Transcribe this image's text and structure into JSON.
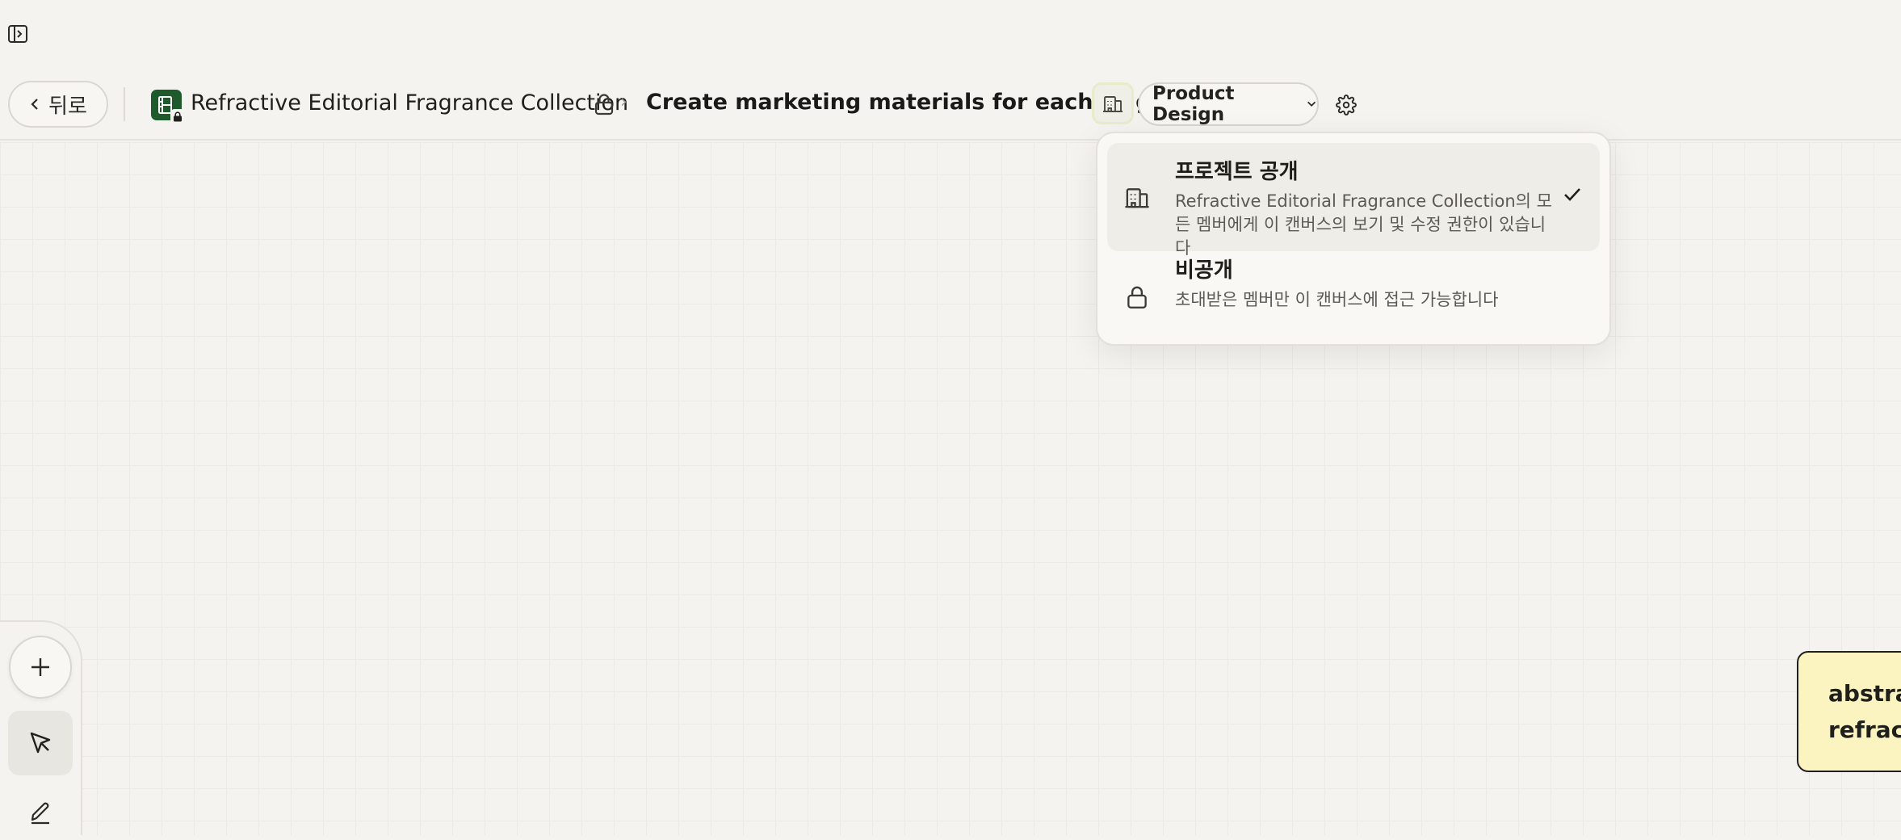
{
  "header": {
    "back_label": "뒤로",
    "project_name": "Refractive Editorial Fragrance Collection",
    "canvas_title": "Create marketing materials for each fragrance",
    "team_select": "Product Design"
  },
  "visibility_menu": {
    "options": [
      {
        "title": "프로젝트 공개",
        "description": "Refractive Editorial Fragrance Collection의 모든 멤버에게 이 캔버스의 보기 및 수정 권한이 있습니다",
        "selected": true,
        "icon": "building-icon"
      },
      {
        "title": "비공개",
        "description": "초대받은 멤버만 이 캔버스에 접근 가능합니다",
        "selected": false,
        "icon": "lock-icon"
      }
    ]
  },
  "canvas": {
    "sticky_note_text": "abstra\nrefract"
  },
  "colors": {
    "background": "#f4f3ef",
    "project_badge": "#1f5a2c",
    "sticky_note": "#fbf3c0"
  }
}
